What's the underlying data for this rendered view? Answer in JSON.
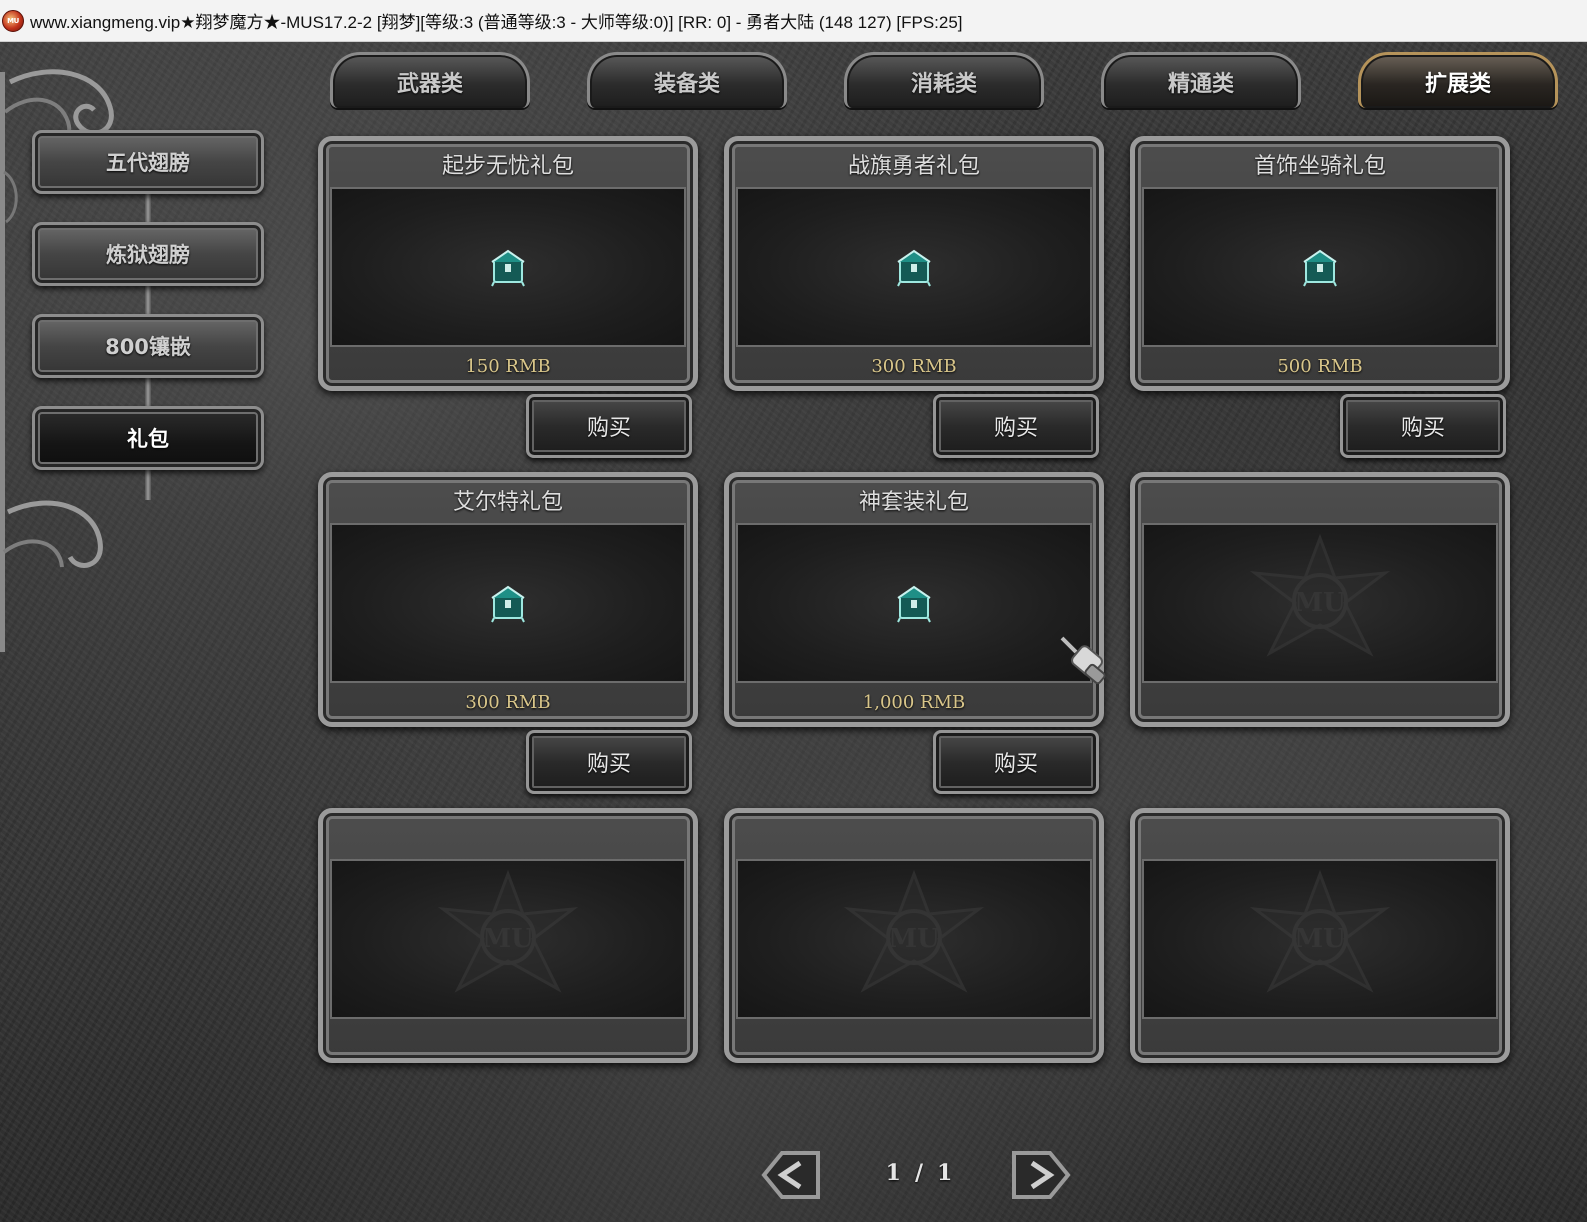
{
  "window": {
    "title": "www.xiangmeng.vip★翔梦魔方★-MUS17.2-2 [翔梦][等级:3 (普通等级:3 - 大师等级:0)] [RR: 0] - 勇者大陆 (148 127) [FPS:25]",
    "icon_label": "MU"
  },
  "category_tabs": [
    {
      "label": "武器类",
      "active": false
    },
    {
      "label": "装备类",
      "active": false
    },
    {
      "label": "消耗类",
      "active": false
    },
    {
      "label": "精通类",
      "active": false
    },
    {
      "label": "扩展类",
      "active": true
    }
  ],
  "side_menu": [
    {
      "label": "五代翅膀",
      "active": false
    },
    {
      "label": "炼狱翅膀",
      "active": false
    },
    {
      "label": "800镶嵌",
      "active": false
    },
    {
      "label": "礼包",
      "active": true
    }
  ],
  "items": [
    {
      "title": "起步无忧礼包",
      "price": "150 RMB",
      "buy_label": "购买",
      "icon": "chest-icon"
    },
    {
      "title": "战旗勇者礼包",
      "price": "300 RMB",
      "buy_label": "购买",
      "icon": "chest-icon"
    },
    {
      "title": "首饰坐骑礼包",
      "price": "500 RMB",
      "buy_label": "购买",
      "icon": "chest-icon"
    },
    {
      "title": "艾尔特礼包",
      "price": "300 RMB",
      "buy_label": "购买",
      "icon": "chest-icon"
    },
    {
      "title": "神套装礼包",
      "price": "1,000 RMB",
      "buy_label": "购买",
      "icon": "chest-icon"
    },
    {
      "title": "",
      "price": "",
      "buy_label": "",
      "icon": "mu-emblem-icon"
    },
    {
      "title": "",
      "price": "",
      "buy_label": "",
      "icon": "mu-emblem-icon"
    },
    {
      "title": "",
      "price": "",
      "buy_label": "",
      "icon": "mu-emblem-icon"
    },
    {
      "title": "",
      "price": "",
      "buy_label": "",
      "icon": "mu-emblem-icon"
    }
  ],
  "pager": {
    "current": "1",
    "separator": "/",
    "total": "1"
  },
  "colors": {
    "price_text": "#d9c68a",
    "active_tab_border": "#b5935a",
    "chest_teal": "#1f8f86"
  }
}
